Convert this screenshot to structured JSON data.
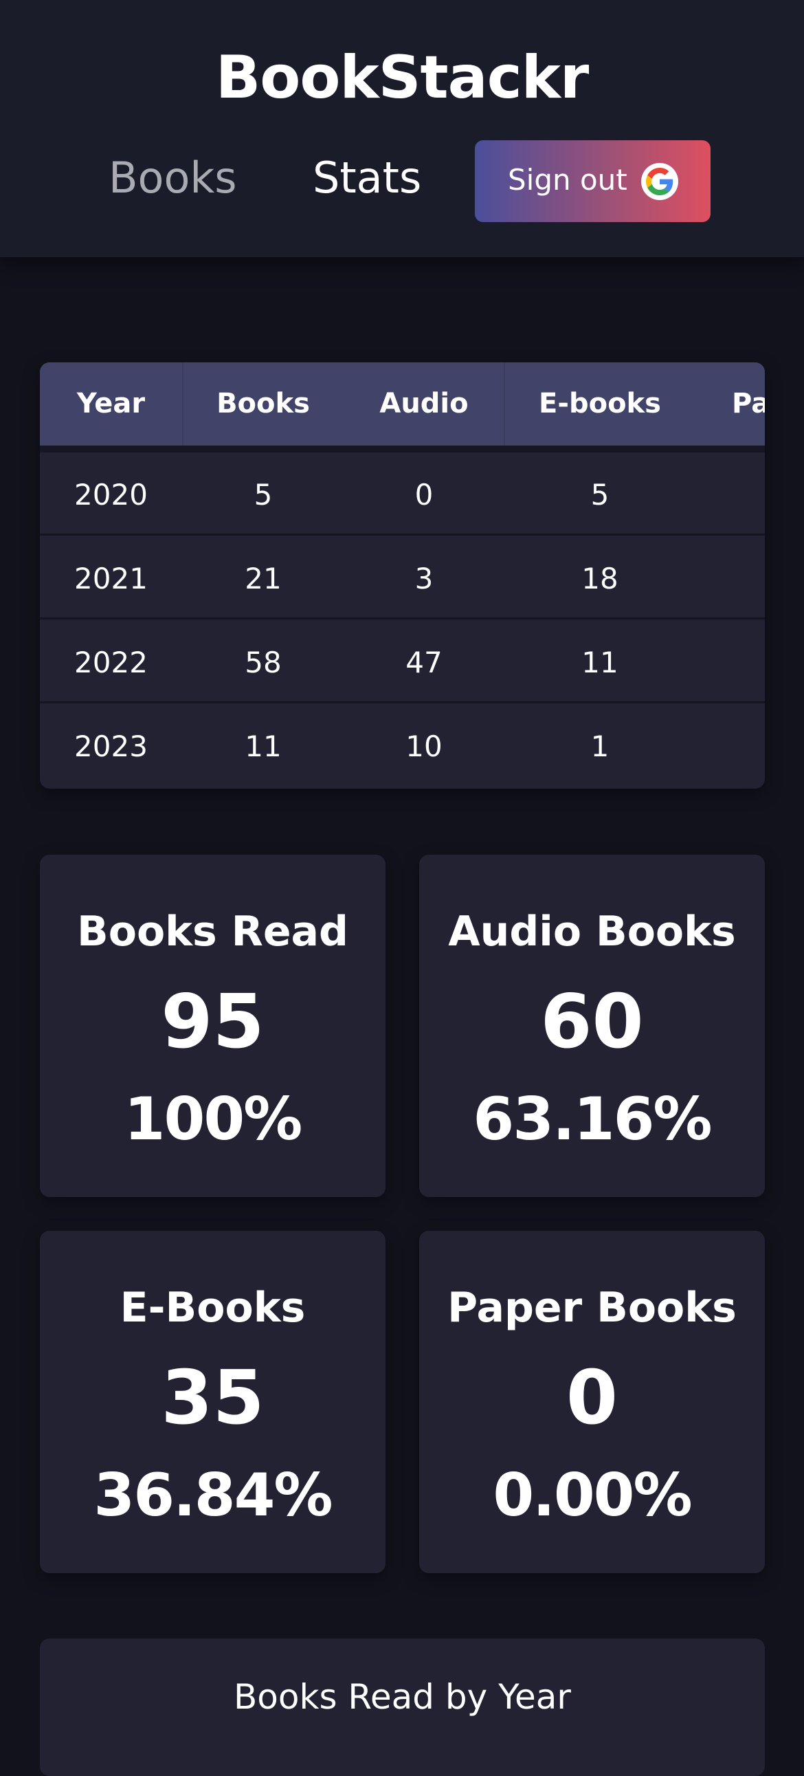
{
  "app": {
    "title": "BookStackr"
  },
  "nav": {
    "books_label": "Books",
    "stats_label": "Stats",
    "signout_label": "Sign out"
  },
  "table": {
    "headers": [
      "Year",
      "Books",
      "Audio",
      "E-books",
      "Pa"
    ],
    "rows": [
      {
        "year": "2020",
        "books": "5",
        "audio": "0",
        "ebooks": "5"
      },
      {
        "year": "2021",
        "books": "21",
        "audio": "3",
        "ebooks": "18"
      },
      {
        "year": "2022",
        "books": "58",
        "audio": "47",
        "ebooks": "11"
      },
      {
        "year": "2023",
        "books": "11",
        "audio": "10",
        "ebooks": "1"
      }
    ]
  },
  "stats": {
    "books_read": {
      "title": "Books Read",
      "value": "95",
      "percent": "100%"
    },
    "audio_books": {
      "title": "Audio Books",
      "value": "60",
      "percent": "63.16%"
    },
    "e_books": {
      "title": "E-Books",
      "value": "35",
      "percent": "36.84%"
    },
    "paper_books": {
      "title": "Paper Books",
      "value": "0",
      "percent": "0.00%"
    }
  },
  "chart": {
    "title": "Books Read by Year"
  },
  "icons": {
    "signout": "google-icon"
  }
}
